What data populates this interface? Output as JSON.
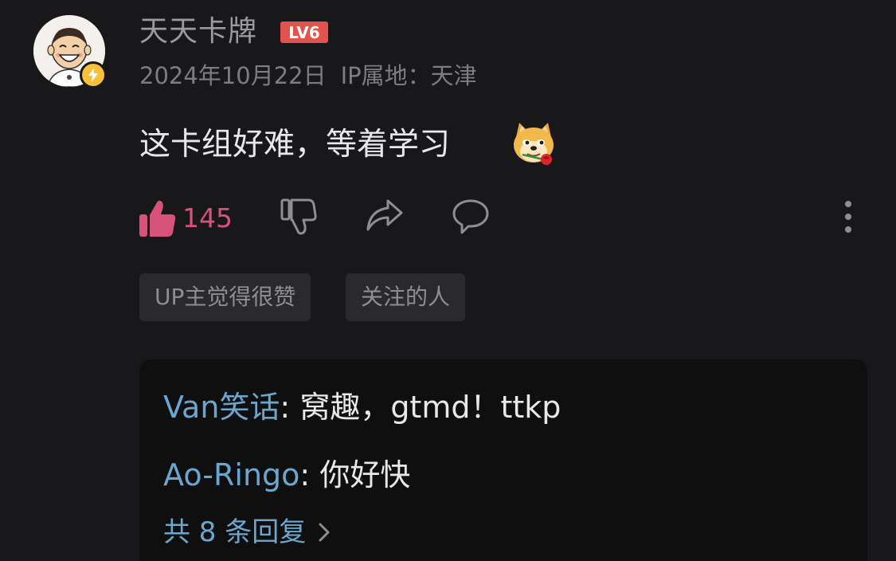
{
  "user": {
    "name": "天天卡牌",
    "level": "LV6",
    "date": "2024年10月22日",
    "ip_location": "IP属地：天津"
  },
  "comment": {
    "text": "这卡组好难，等着学习",
    "emoji": "doge-rose-emoji"
  },
  "actions": {
    "like_count": "145",
    "icons": [
      "thumbs-up-icon",
      "thumbs-down-icon",
      "share-icon",
      "comment-icon",
      "more-icon"
    ]
  },
  "tags": [
    "UP主觉得很赞",
    "关注的人"
  ],
  "replies": [
    {
      "author": "Van笑话",
      "separator": ": ",
      "text": "窝趣，gtmd！ttkp"
    },
    {
      "author": "Ao-Ringo",
      "separator": ": ",
      "text": "你好快"
    }
  ],
  "reply_more": "共 8 条回复",
  "colors": {
    "background": "#18181a",
    "like_pink": "#d7527a",
    "link_blue": "#6ba6cf",
    "level_red": "#e2534d",
    "badge_yellow": "#f7c13a"
  }
}
